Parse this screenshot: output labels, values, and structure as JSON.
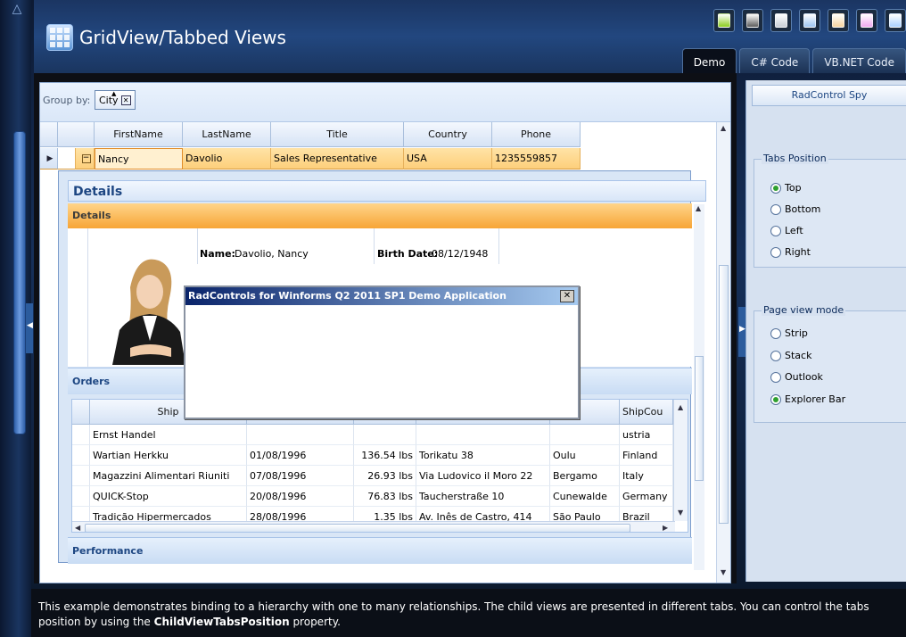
{
  "app": {
    "title": "GridView/Tabbed Views",
    "tabs": [
      "Demo",
      "C# Code",
      "VB.NET Code"
    ],
    "active_tab": "Demo",
    "theme_swatches": [
      "#8ccc1e",
      "#5c5c5c",
      "#c9ced6",
      "#9ec5f0",
      "#f5d3a0",
      "#f0a8f0",
      "#a9d0ff"
    ]
  },
  "grid": {
    "group_by_label": "Group by:",
    "group_chip": "City",
    "columns": [
      "FirstName",
      "LastName",
      "Title",
      "Country",
      "Phone"
    ],
    "row": {
      "FirstName": "Nancy",
      "LastName": "Davolio",
      "Title": "Sales Representative",
      "Country": "USA",
      "Phone": "1235559857"
    }
  },
  "detail": {
    "title": "Details",
    "tab_details": "Details",
    "name_label": "Name:",
    "name_value": "Davolio, Nancy",
    "birth_label": "Birth Date:",
    "birth_value": "08/12/1948",
    "tab_orders": "Orders",
    "tab_performance": "Performance",
    "orders": {
      "columns": [
        "",
        "Ship",
        "",
        "",
        "",
        "",
        "ShipCou"
      ],
      "rows": [
        [
          "Ernst Handel",
          "",
          "",
          "",
          "",
          "ustria"
        ],
        [
          "Wartian Herkku",
          "01/08/1996",
          "136.54 lbs",
          "Torikatu 38",
          "Oulu",
          "Finland"
        ],
        [
          "Magazzini Alimentari Riuniti",
          "07/08/1996",
          "26.93 lbs",
          "Via Ludovico il Moro 22",
          "Bergamo",
          "Italy"
        ],
        [
          "QUICK-Stop",
          "20/08/1996",
          "76.83 lbs",
          "Taucherstraße 10",
          "Cunewalde",
          "Germany"
        ],
        [
          "Tradição Hipermercados",
          "28/08/1996",
          "1.35 lbs",
          "Av. Inês de Castro, 414",
          "São Paulo",
          "Brazil"
        ]
      ]
    }
  },
  "dialog": {
    "title": "RadControls for Winforms Q2 2011 SP1 Demo Application",
    "close": "✕"
  },
  "settings": {
    "spy_button": "RadControl Spy",
    "tabs_position_title": "Tabs Position",
    "tabs_position_options": [
      "Top",
      "Bottom",
      "Left",
      "Right"
    ],
    "tabs_position_selected": "Top",
    "page_view_title": "Page view mode",
    "page_view_options": [
      "Strip",
      "Stack",
      "Outlook",
      "Explorer Bar"
    ],
    "page_view_selected": "Explorer Bar"
  },
  "footer": {
    "text_1": "This example demonstrates binding to a hierarchy with one to many relationships. The child views are presented in different tabs. You can control the tabs position by using the",
    "property": "ChildViewTabsPosition",
    "text_2": " property."
  }
}
